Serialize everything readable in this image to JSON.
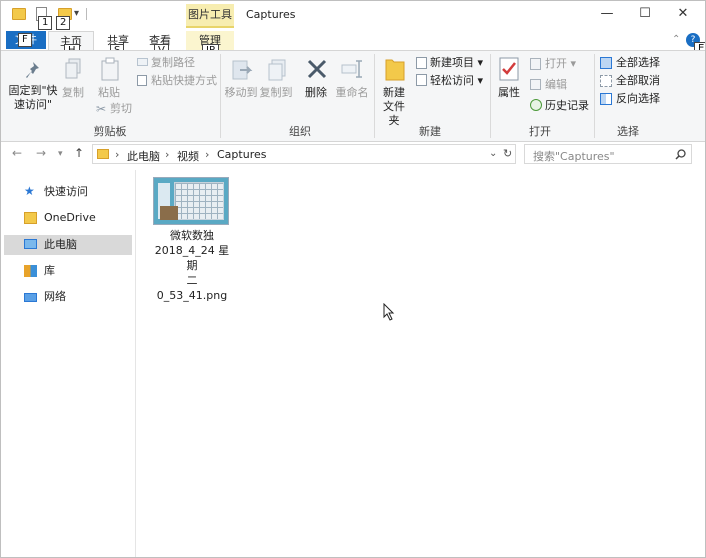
{
  "window": {
    "title": "Captures",
    "contextual_tab": "图片工具",
    "minimize": "—",
    "maximize": "☐",
    "close": "✕"
  },
  "keytips": {
    "qat_1": "1",
    "qat_2": "2",
    "file": "F",
    "home": "H",
    "share": "S",
    "view": "V",
    "manage": "JP",
    "help": "E"
  },
  "tabs": {
    "file": "文件",
    "home": "主页",
    "share": "共享",
    "view": "查看",
    "manage": "管理"
  },
  "ribbon": {
    "clipboard": {
      "label": "剪贴板",
      "pin": "固定到\"快速访问\"",
      "copy": "复制",
      "paste": "粘贴",
      "copy_path": "复制路径",
      "paste_shortcut": "粘贴快捷方式",
      "cut": "剪切"
    },
    "organize": {
      "label": "组织",
      "move_to": "移动到",
      "copy_to": "复制到",
      "delete": "删除",
      "rename": "重命名"
    },
    "new": {
      "label": "新建",
      "new_folder_line1": "新建",
      "new_folder_line2": "文件夹",
      "new_item": "新建项目",
      "easy_access": "轻松访问"
    },
    "open": {
      "label": "打开",
      "properties": "属性",
      "open": "打开",
      "edit": "编辑",
      "history": "历史记录"
    },
    "select": {
      "label": "选择",
      "select_all": "全部选择",
      "select_none": "全部取消",
      "invert": "反向选择"
    }
  },
  "address": {
    "crumbs": [
      "此电脑",
      "视频",
      "Captures"
    ],
    "search_placeholder": "搜索\"Captures\""
  },
  "nav": {
    "items": [
      {
        "label": "快速访问",
        "icon": "star-icon",
        "color": "#2b78d4"
      },
      {
        "label": "OneDrive",
        "icon": "folder-icon",
        "color": "#f3c94a"
      },
      {
        "label": "此电脑",
        "icon": "computer-icon",
        "color": "#3a8fd8"
      },
      {
        "label": "库",
        "icon": "library-icon",
        "color": "#e8a32a"
      },
      {
        "label": "网络",
        "icon": "network-icon",
        "color": "#2b78d4"
      }
    ]
  },
  "files": [
    {
      "name_line1": "微软数独",
      "name_line2": "2018_4_24 星期",
      "name_line3": "二 0_53_41.png"
    }
  ],
  "colors": {
    "accent": "#1a6ec3",
    "contextual": "#f7edb0",
    "selected": "#d9d9d9"
  }
}
